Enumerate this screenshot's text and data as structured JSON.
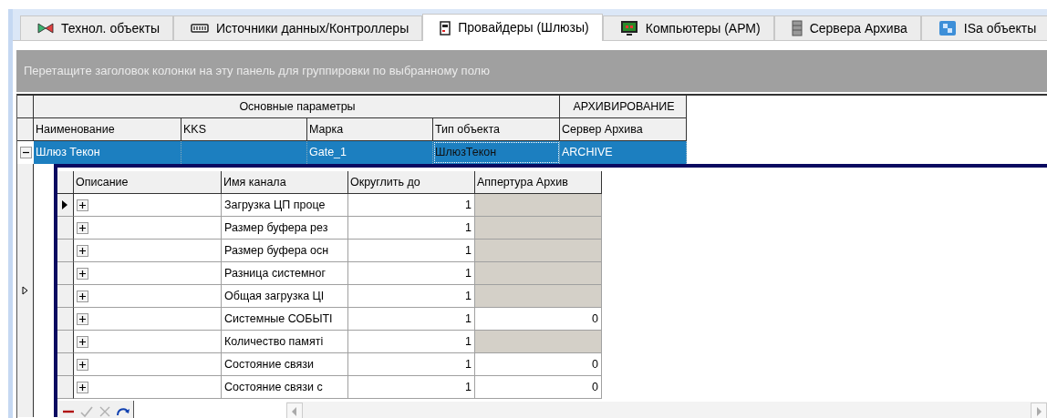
{
  "tabs": [
    {
      "label": "Технол. объекты",
      "selected": false
    },
    {
      "label": "Источники данных/Контроллеры",
      "selected": false
    },
    {
      "label": "Провайдеры (Шлюзы)",
      "selected": true
    },
    {
      "label": "Компьютеры (АРМ)",
      "selected": false
    },
    {
      "label": "Сервера Архива",
      "selected": false
    },
    {
      "label": "ISa объекты",
      "selected": false
    }
  ],
  "group_panel": {
    "hint": "Перетащите заголовок колонки на эту панель для группировки по выбранному полю"
  },
  "master_grid": {
    "bands": [
      {
        "label": "Основные параметры",
        "columns": [
          "Наименование",
          "KKS",
          "Марка",
          "Тип объекта"
        ]
      },
      {
        "label": "АРХИВИРОВАНИЕ",
        "columns": [
          "Сервер Архива"
        ]
      }
    ],
    "rows": [
      {
        "expanded": true,
        "selected": true,
        "cells": [
          {
            "text": "Шлюз Текон",
            "focused": false
          },
          {
            "text": "",
            "focused": false
          },
          {
            "text": "Gate_1",
            "focused": false
          },
          {
            "text": "ШлюзТекон",
            "focused": true
          },
          {
            "text": "ARCHIVE",
            "focused": false
          }
        ]
      }
    ]
  },
  "detail_grid": {
    "columns": [
      "Описание",
      "Имя канала",
      "Округлить до",
      "Аппертура Архив"
    ],
    "rows": [
      {
        "selected": true,
        "expanded": false,
        "channel": "Загрузка ЦП проце",
        "round_to": "1",
        "aperture_disabled": true
      },
      {
        "selected": false,
        "expanded": false,
        "channel": "Размер буфера рез",
        "round_to": "1",
        "aperture_disabled": true
      },
      {
        "selected": false,
        "expanded": false,
        "channel": "Размер буфера осн",
        "round_to": "1",
        "aperture_disabled": true
      },
      {
        "selected": false,
        "expanded": false,
        "channel": "Разница системног",
        "round_to": "1",
        "aperture_disabled": true
      },
      {
        "selected": false,
        "expanded": false,
        "channel": "Общая загрузка ЦІ",
        "round_to": "1",
        "aperture_disabled": true
      },
      {
        "selected": false,
        "expanded": false,
        "channel": "Системные СОБЫТІ",
        "round_to": "1",
        "aperture": "0",
        "aperture_disabled": false
      },
      {
        "selected": false,
        "expanded": false,
        "channel": "Количество памяті",
        "round_to": "1",
        "aperture_disabled": true
      },
      {
        "selected": false,
        "expanded": false,
        "channel": "Состояние связи",
        "round_to": "1",
        "aperture": "0",
        "aperture_disabled": false
      },
      {
        "selected": false,
        "expanded": false,
        "channel": "Состояние связи с",
        "round_to": "1",
        "aperture": "0",
        "aperture_disabled": false
      }
    ],
    "navigator": [
      {
        "kind": "delete",
        "disabled": false
      },
      {
        "kind": "post",
        "disabled": true
      },
      {
        "kind": "cancel",
        "disabled": true
      },
      {
        "kind": "refresh",
        "disabled": false
      }
    ]
  }
}
